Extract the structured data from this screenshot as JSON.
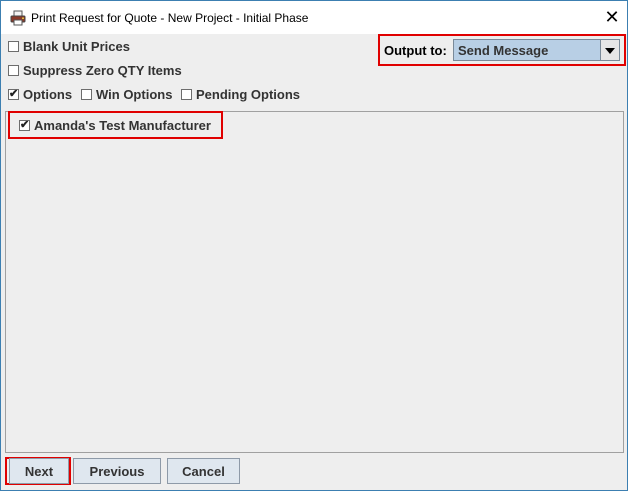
{
  "window": {
    "title": "Print Request for Quote - New Project - Initial Phase",
    "close_label": "✕"
  },
  "options": {
    "blank_unit_prices": {
      "label": "Blank Unit Prices",
      "checked": false
    },
    "suppress_zero_qty": {
      "label": "Suppress Zero QTY Items",
      "checked": false
    },
    "options": {
      "label": "Options",
      "checked": true
    },
    "win_options": {
      "label": "Win Options",
      "checked": false
    },
    "pending_options": {
      "label": "Pending Options",
      "checked": false
    }
  },
  "output": {
    "label": "Output to:",
    "selected": "Send Message"
  },
  "manufacturers": [
    {
      "label": "Amanda's Test Manufacturer",
      "checked": true
    }
  ],
  "buttons": {
    "next": "Next",
    "previous": "Previous",
    "cancel": "Cancel"
  },
  "colors": {
    "highlight": "#e00000",
    "select_bg": "#b8cfe5",
    "button_bg": "#dfe7ef",
    "window_border": "#3c7fb1"
  }
}
